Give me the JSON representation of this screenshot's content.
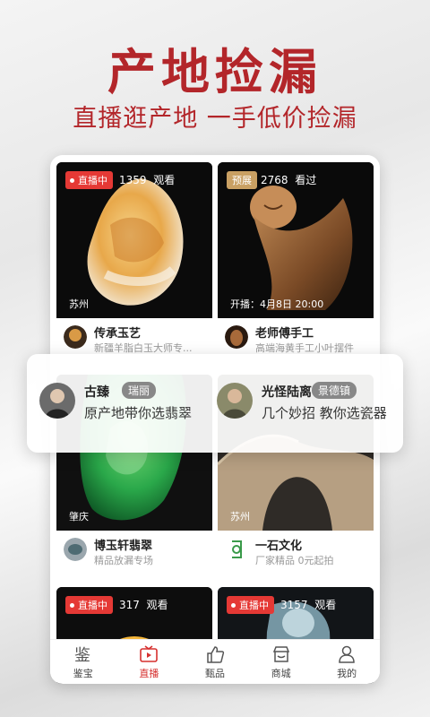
{
  "hero": {
    "title": "产地捡漏",
    "subtitle": "直播逛产地 一手低价捡漏"
  },
  "cards": [
    {
      "badge": "直播中",
      "badge_type": "live",
      "count": "1359",
      "count_label": "观看",
      "location": "苏州",
      "name": "传承玉艺",
      "desc": "新疆羊脂白玉大师专..."
    },
    {
      "badge": "预展",
      "badge_type": "preview",
      "count": "2768",
      "count_label": "看过",
      "start": "开播：4月8日 20:00",
      "name": "老师傅手工",
      "desc": "高端海黄手工小叶摆件"
    },
    {
      "location": "肇庆",
      "name": "博玉轩翡翠",
      "desc": "精品放漏专场"
    },
    {
      "location": "苏州",
      "name": "一石文化",
      "desc": "厂家精品 0元起拍"
    },
    {
      "badge": "直播中",
      "badge_type": "live",
      "count": "317",
      "count_label": "观看"
    },
    {
      "badge": "直播中",
      "badge_type": "live",
      "count": "3157",
      "count_label": "观看"
    }
  ],
  "popup": [
    {
      "name": "古臻",
      "tag": "瑞丽",
      "desc": "原产地带你选翡翠"
    },
    {
      "name": "光怪陆离",
      "tag": "景德镇",
      "desc": "几个妙招 教你选瓷器"
    }
  ],
  "tabs": [
    {
      "label": "鉴宝",
      "icon": "jian-glyph-icon"
    },
    {
      "label": "直播",
      "icon": "tv-play-icon",
      "active": true
    },
    {
      "label": "甄品",
      "icon": "thumbs-up-icon"
    },
    {
      "label": "商城",
      "icon": "shop-icon"
    },
    {
      "label": "我的",
      "icon": "person-icon"
    }
  ],
  "colors": {
    "brand": "#b3262a",
    "live_badge": "#e53935",
    "preview_badge": "#c9a063",
    "active_tab": "#d6302f"
  }
}
